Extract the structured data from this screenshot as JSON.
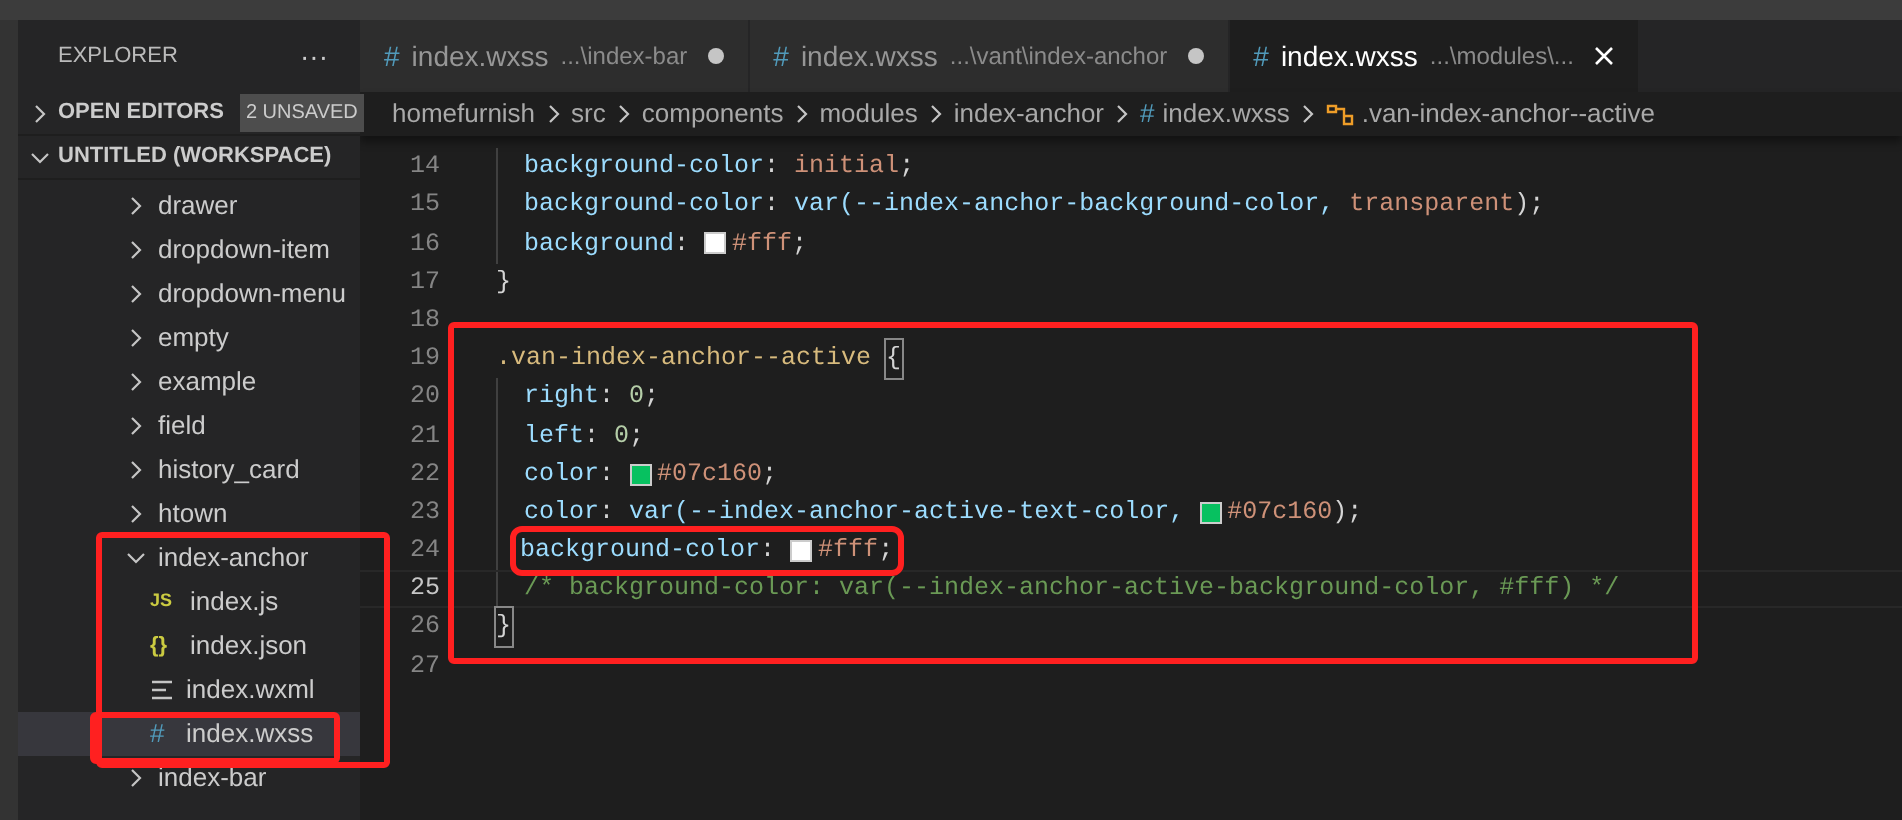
{
  "sidebar": {
    "title": "EXPLORER",
    "more": "···",
    "sections": [
      {
        "label": "OPEN EDITORS",
        "badge": "2 UNSAVED",
        "expanded": false
      },
      {
        "label": "UNTITLED (WORKSPACE)",
        "expanded": true
      }
    ],
    "tree": [
      {
        "name": "drawer",
        "kind": "folder",
        "expanded": false
      },
      {
        "name": "dropdown-item",
        "kind": "folder",
        "expanded": false
      },
      {
        "name": "dropdown-menu",
        "kind": "folder",
        "expanded": false
      },
      {
        "name": "empty",
        "kind": "folder",
        "expanded": false
      },
      {
        "name": "example",
        "kind": "folder",
        "expanded": false
      },
      {
        "name": "field",
        "kind": "folder",
        "expanded": false
      },
      {
        "name": "history_card",
        "kind": "folder",
        "expanded": false
      },
      {
        "name": "htown",
        "kind": "folder",
        "expanded": false
      },
      {
        "name": "index-anchor",
        "kind": "folder",
        "expanded": true,
        "annotated": true,
        "children": [
          {
            "name": "index.js",
            "kind": "js",
            "icon": "JS",
            "selected": false,
            "annotated": false
          },
          {
            "name": "index.json",
            "kind": "json",
            "icon": "{}",
            "selected": false,
            "annotated": false
          },
          {
            "name": "index.wxml",
            "kind": "wxml",
            "selected": false,
            "annotated": false
          },
          {
            "name": "index.wxss",
            "kind": "wxss",
            "icon": "#",
            "selected": true,
            "annotated": true
          }
        ]
      },
      {
        "name": "index-bar",
        "kind": "folder",
        "expanded": false
      }
    ]
  },
  "tabs": [
    {
      "icon": "#",
      "name": "index.wxss",
      "path": "...\\index-bar",
      "selected": false,
      "unsaved": true
    },
    {
      "icon": "#",
      "name": "index.wxss",
      "path": "...\\vant\\index-anchor",
      "selected": false,
      "unsaved": true
    },
    {
      "icon": "#",
      "name": "index.wxss",
      "path": "...\\modules\\...",
      "selected": true,
      "unsaved": false
    }
  ],
  "breadcrumb": [
    {
      "label": "homefurnish",
      "kind": "folder"
    },
    {
      "label": "src",
      "kind": "folder"
    },
    {
      "label": "components",
      "kind": "folder"
    },
    {
      "label": "modules",
      "kind": "folder"
    },
    {
      "label": "index-anchor",
      "kind": "folder"
    },
    {
      "label": "index.wxss",
      "kind": "file",
      "icon": "#"
    },
    {
      "label": ".van-index-anchor--active",
      "kind": "symbol"
    }
  ],
  "code": {
    "blocks": [
      {
        "annotated": false,
        "lines": [
          {
            "number": "14",
            "indented": true,
            "current": false,
            "boxed": false,
            "tokens": [
              {
                "kind": "prop",
                "text": "background-color"
              },
              {
                "kind": "punct",
                "text": ": "
              },
              {
                "kind": "value",
                "text": "initial"
              },
              {
                "kind": "punct",
                "text": ";"
              }
            ]
          },
          {
            "number": "15",
            "indented": true,
            "current": false,
            "boxed": false,
            "tokens": [
              {
                "kind": "prop",
                "text": "background-color"
              },
              {
                "kind": "punct",
                "text": ": "
              },
              {
                "kind": "prop",
                "text": "var(--index-anchor-background-color, "
              },
              {
                "kind": "value",
                "text": "transparent"
              },
              {
                "kind": "punct",
                "text": ");"
              }
            ]
          },
          {
            "number": "16",
            "indented": true,
            "current": false,
            "boxed": false,
            "tokens": [
              {
                "kind": "prop",
                "text": "background"
              },
              {
                "kind": "punct",
                "text": ": "
              },
              {
                "kind": "swatch",
                "color": "#ffffff"
              },
              {
                "kind": "value",
                "text": "#fff"
              },
              {
                "kind": "punct",
                "text": ";"
              }
            ]
          },
          {
            "number": "17",
            "indented": false,
            "current": false,
            "boxed": false,
            "tokens": [
              {
                "kind": "punct",
                "text": "}"
              }
            ]
          },
          {
            "number": "18",
            "indented": false,
            "current": false
          }
        ]
      },
      {
        "annotated": true,
        "lines": [
          {
            "number": "19",
            "indented": false,
            "current": false,
            "boxed": false,
            "tokens": [
              {
                "kind": "selector",
                "text": ".van-index-anchor--active "
              },
              {
                "kind": "bracket",
                "text": "{"
              }
            ]
          },
          {
            "number": "20",
            "indented": true,
            "current": false,
            "boxed": false,
            "tokens": [
              {
                "kind": "prop",
                "text": "right"
              },
              {
                "kind": "punct",
                "text": ": "
              },
              {
                "kind": "number",
                "text": "0"
              },
              {
                "kind": "punct",
                "text": ";"
              }
            ]
          },
          {
            "number": "21",
            "indented": true,
            "current": false,
            "boxed": false,
            "tokens": [
              {
                "kind": "prop",
                "text": "left"
              },
              {
                "kind": "punct",
                "text": ": "
              },
              {
                "kind": "number",
                "text": "0"
              },
              {
                "kind": "punct",
                "text": ";"
              }
            ]
          },
          {
            "number": "22",
            "indented": true,
            "current": false,
            "boxed": false,
            "tokens": [
              {
                "kind": "prop",
                "text": "color"
              },
              {
                "kind": "punct",
                "text": ": "
              },
              {
                "kind": "swatch",
                "color": "#07c160"
              },
              {
                "kind": "value",
                "text": "#07c160"
              },
              {
                "kind": "punct",
                "text": ";"
              }
            ]
          },
          {
            "number": "23",
            "indented": true,
            "current": false,
            "boxed": false,
            "tokens": [
              {
                "kind": "prop",
                "text": "color"
              },
              {
                "kind": "punct",
                "text": ": "
              },
              {
                "kind": "prop",
                "text": "var(--index-anchor-active-text-color, "
              },
              {
                "kind": "swatch",
                "color": "#07c160"
              },
              {
                "kind": "value",
                "text": "#07c160"
              },
              {
                "kind": "punct",
                "text": ");"
              }
            ]
          },
          {
            "number": "24",
            "indented": true,
            "current": false,
            "boxed": true,
            "tokens": [
              {
                "kind": "prop",
                "text": "background-color"
              },
              {
                "kind": "punct",
                "text": ": "
              },
              {
                "kind": "swatch",
                "color": "#ffffff"
              },
              {
                "kind": "value",
                "text": "#fff"
              },
              {
                "kind": "punct",
                "text": ";"
              }
            ]
          },
          {
            "number": "25",
            "indented": true,
            "current": true,
            "boxed": false,
            "tokens": [
              {
                "kind": "comment",
                "text": "/* background-color: var(--index-anchor-active-background-color, #fff) */"
              }
            ]
          },
          {
            "number": "26",
            "indented": false,
            "current": false,
            "boxed": false,
            "tokens": [
              {
                "kind": "bracket",
                "text": "}"
              }
            ]
          }
        ]
      },
      {
        "annotated": false,
        "lines": [
          {
            "number": "27",
            "indented": false,
            "current": false
          }
        ]
      }
    ]
  }
}
